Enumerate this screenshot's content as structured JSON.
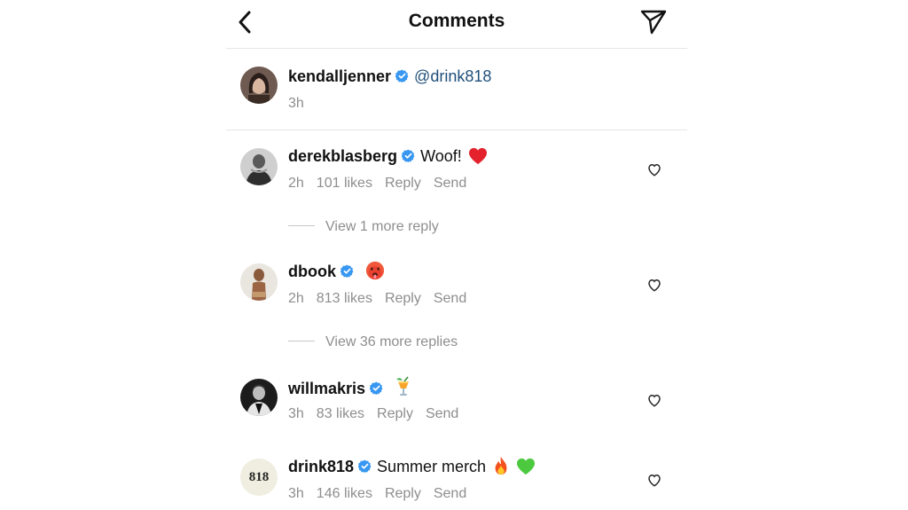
{
  "header": {
    "title": "Comments"
  },
  "post": {
    "username": "kendalljenner",
    "caption": "@drink818",
    "time": "3h"
  },
  "comments": [
    {
      "username": "derekblasberg",
      "text": "Woof!",
      "emoji": "red-heart",
      "time": "2h",
      "likes": "101 likes",
      "reply": "Reply",
      "send": "Send",
      "view_more": "View 1 more reply"
    },
    {
      "username": "dbook",
      "text": "",
      "emoji": "hot-face",
      "time": "2h",
      "likes": "813 likes",
      "reply": "Reply",
      "send": "Send",
      "view_more": "View 36 more replies"
    },
    {
      "username": "willmakris",
      "text": "",
      "emoji": "tropical-drink",
      "time": "3h",
      "likes": "83 likes",
      "reply": "Reply",
      "send": "Send",
      "view_more": ""
    },
    {
      "username": "drink818",
      "text": "Summer merch",
      "emoji": "fire + green-heart",
      "time": "3h",
      "likes": "146 likes",
      "reply": "Reply",
      "send": "Send",
      "view_more": "",
      "avatar_text": "818"
    }
  ],
  "colors": {
    "verified": "#3897f0",
    "mention": "#1f4f7a",
    "meta": "#8e8e8e"
  }
}
